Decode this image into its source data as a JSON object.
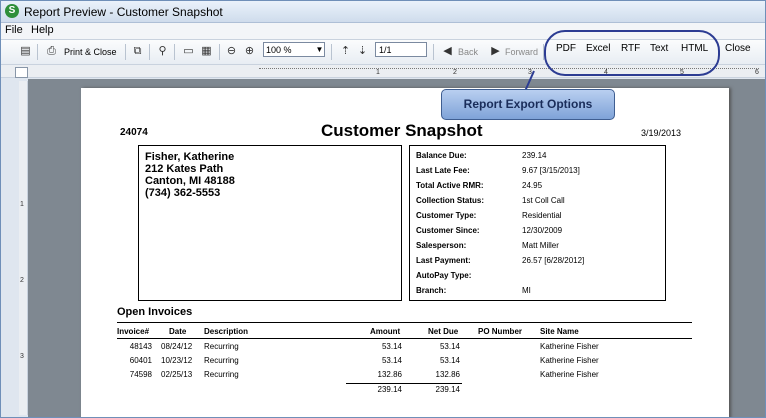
{
  "window": {
    "title": "Report Preview - Customer Snapshot"
  },
  "menu": [
    "File",
    "Help"
  ],
  "toolbar": {
    "print_close": "Print & Close",
    "zoom": "100 %",
    "page": "1/1",
    "back": "Back",
    "forward": "Forward",
    "export": [
      "PDF",
      "Excel",
      "RTF",
      "Text",
      "HTML"
    ],
    "close": "Close"
  },
  "callout": {
    "text": "Report Export Options"
  },
  "ruler": {
    "h": [
      "1",
      "2",
      "3",
      "4",
      "5",
      "6"
    ],
    "v": [
      "1",
      "2",
      "3"
    ]
  },
  "report": {
    "title": "Customer Snapshot",
    "customer_id": "24074",
    "date": "3/19/2013",
    "address": [
      "Fisher, Katherine",
      "212  Kates Path",
      "Canton,  MI 48188",
      "(734) 362-5553"
    ],
    "info": [
      {
        "label": "Balance Due:",
        "value": "239.14"
      },
      {
        "label": "Last Late Fee:",
        "value": "9.67  [3/15/2013]"
      },
      {
        "label": "Total Active RMR:",
        "value": "24.95"
      },
      {
        "label": "Collection Status:",
        "value": "1st Coll Call"
      },
      {
        "label": "Customer Type:",
        "value": "Residential"
      },
      {
        "label": "Customer Since:",
        "value": "12/30/2009"
      },
      {
        "label": "Salesperson:",
        "value": "Matt Miller"
      },
      {
        "label": "Last Payment:",
        "value": "26.57  [6/28/2012]"
      },
      {
        "label": "AutoPay Type:",
        "value": ""
      },
      {
        "label": "Branch:",
        "value": "MI"
      }
    ],
    "invoices": {
      "title": "Open Invoices",
      "headers": [
        "Invoice#",
        "Date",
        "Description",
        "Amount",
        "Net Due",
        "PO Number",
        "Site Name"
      ],
      "rows": [
        [
          "48143",
          "08/24/12",
          "Recurring",
          "53.14",
          "53.14",
          "",
          "Katherine Fisher"
        ],
        [
          "60401",
          "10/23/12",
          "Recurring",
          "53.14",
          "53.14",
          "",
          "Katherine Fisher"
        ],
        [
          "74598",
          "02/25/13",
          "Recurring",
          "132.86",
          "132.86",
          "",
          "Katherine Fisher"
        ]
      ],
      "totals": {
        "amount": "239.14",
        "net_due": "239.14"
      }
    }
  }
}
